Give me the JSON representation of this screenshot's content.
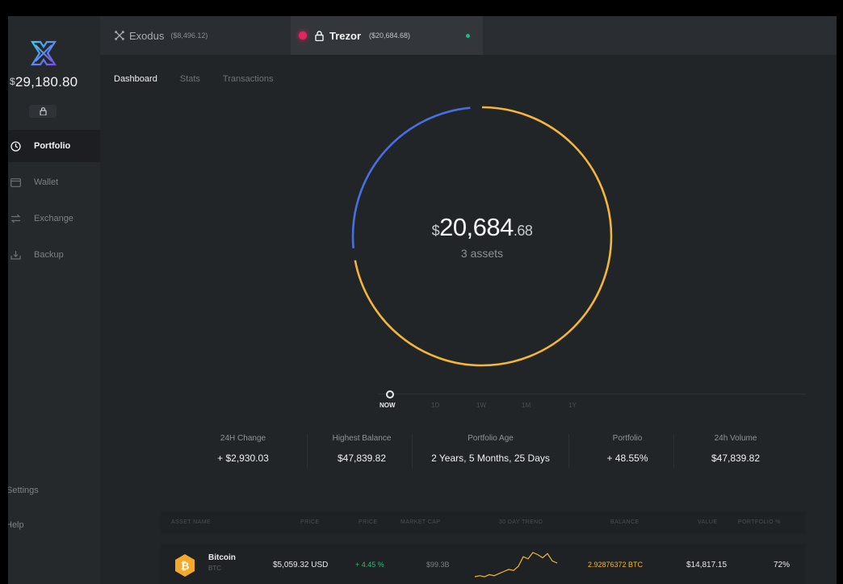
{
  "sidebar": {
    "total_currency": "$",
    "total_amount": "29,180.80",
    "nav": [
      {
        "label": "Portfolio",
        "icon": "clock-icon"
      },
      {
        "label": "Wallet",
        "icon": "wallet-icon"
      },
      {
        "label": "Exchange",
        "icon": "exchange-icon"
      },
      {
        "label": "Backup",
        "icon": "backup-icon"
      }
    ],
    "settings_label": "Settings",
    "help_label": "Help"
  },
  "wallets": [
    {
      "name": "Exodus",
      "balance": "($8,496.12)",
      "icon": "exodus-icon"
    },
    {
      "name": "Trezor",
      "balance": "($20,684.68)",
      "icon": "lock-icon"
    }
  ],
  "tabs": [
    "Dashboard",
    "Stats",
    "Transactions"
  ],
  "portfolio": {
    "currency": "$",
    "balance_main": "20,684",
    "balance_cents": ".68",
    "assets_label": "3 assets",
    "segments": [
      {
        "color": "#f3b53a",
        "fraction": 0.72
      },
      {
        "color": "#4a6ee0",
        "fraction": 0.25
      }
    ]
  },
  "timeline": {
    "ranges": [
      "NOW",
      "1D",
      "1W",
      "1M",
      "1Y"
    ],
    "active": "NOW"
  },
  "stats": [
    {
      "label": "24H Change",
      "value": "+ $2,930.03"
    },
    {
      "label": "Highest Balance",
      "value": "$47,839.82"
    },
    {
      "label": "Portfolio Age",
      "value": "2 Years, 5 Months, 25 Days"
    },
    {
      "label": "Portfolio",
      "value": "+ 48.55%"
    },
    {
      "label": "24h Volume",
      "value": "$47,839.82"
    }
  ],
  "table": {
    "headers": [
      "ASSET NAME",
      "PRICE",
      "PRICE",
      "MARKET CAP",
      "30 DAY TREND",
      "BALANCE",
      "VALUE",
      "PORTFOLIO %"
    ],
    "rows": [
      {
        "name": "Bitcoin",
        "ticker": "BTC",
        "price": "$5,059.32 USD",
        "change": "+ 4.45 %",
        "market_cap": "$99.3B",
        "balance": "2.92876372 BTC",
        "value": "$14,817.15",
        "portfolio_pct": "72%",
        "trend": [
          3,
          4,
          3,
          5,
          4,
          6,
          8,
          10,
          9,
          13,
          22,
          20,
          26,
          24,
          21,
          25,
          18,
          16
        ]
      }
    ]
  },
  "colors": {
    "accent_gold": "#f3b53a",
    "accent_blue": "#4a6ee0",
    "positive": "#27c26a",
    "record": "#e8245f"
  }
}
